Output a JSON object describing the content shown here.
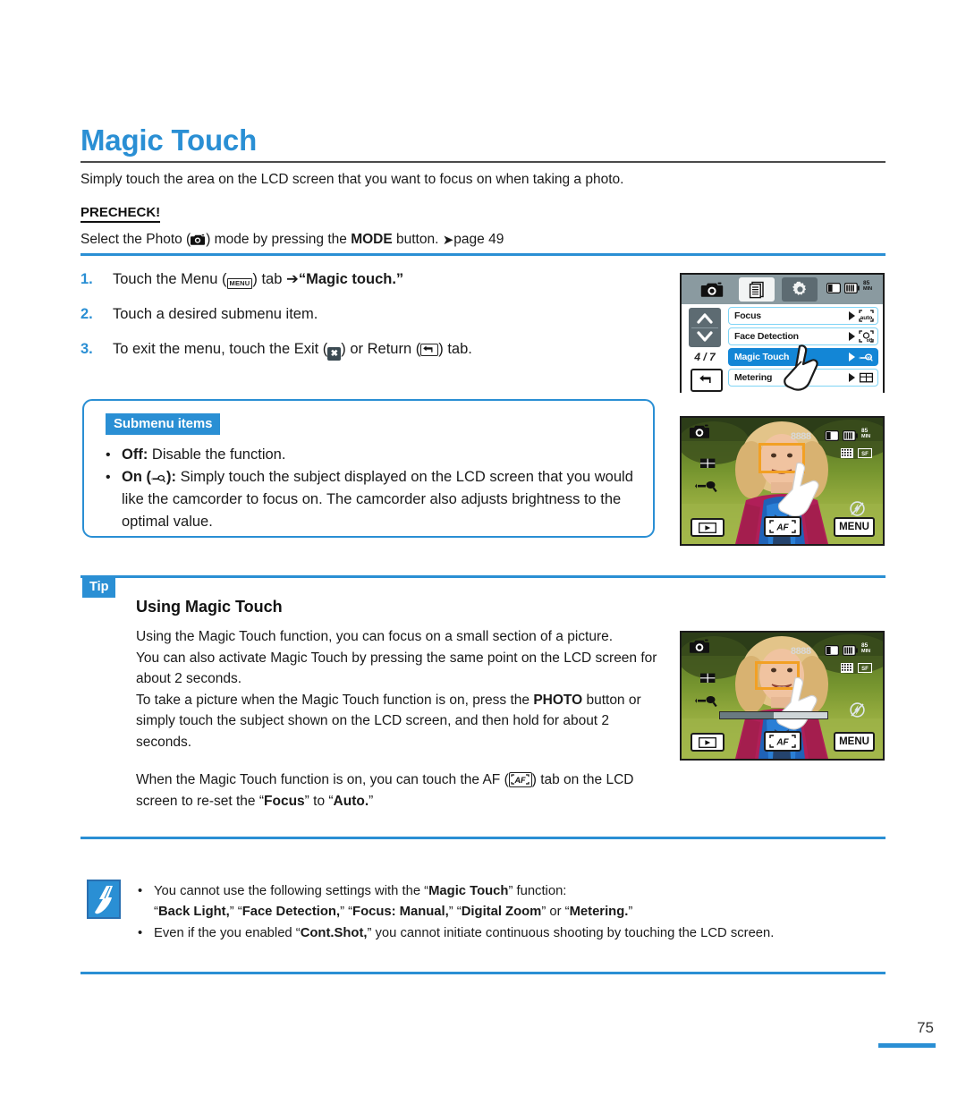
{
  "page": {
    "title": "Magic Touch",
    "intro": "Simply touch the area on the LCD screen that you want to focus on when taking a photo.",
    "precheck_label": "PRECHECK!",
    "precheck_prefix": "Select the Photo (",
    "precheck_mid": ") mode by pressing the ",
    "precheck_mode": "MODE",
    "precheck_suffix": " button. ",
    "precheck_ref": "page 49",
    "page_number": "75",
    "accent_color": "#2a8fd4"
  },
  "steps": [
    {
      "num": "1.",
      "pre": "Touch the Menu (",
      "chip": "MENU",
      "mid": ") tab ",
      "arrow": "➔",
      "bold": "“Magic touch.”",
      "post": ""
    },
    {
      "num": "2.",
      "pre": "Touch a desired submenu item.",
      "mid": "",
      "bold": "",
      "post": ""
    },
    {
      "num": "3.",
      "pre": "To exit the menu, touch the Exit (",
      "mid": ") or Return (",
      "post": ") tab."
    }
  ],
  "submenu": {
    "tag": "Submenu items",
    "items": [
      {
        "bold": "Off:",
        "text": " Disable the function."
      },
      {
        "bold": "On (",
        "icon": "magic-touch-icon",
        "bold2": "):",
        "text": " Simply touch the subject displayed on the LCD screen that you would like the camcorder to focus on. The camcorder also adjusts brightness to the optimal value."
      }
    ]
  },
  "tip": {
    "tag": "Tip",
    "heading": "Using Magic Touch",
    "paragraphs": [
      "Using the Magic Touch function, you can focus on a small section of a picture.",
      "You can also activate Magic Touch by pressing the same point on the LCD screen for about 2 seconds."
    ],
    "photo_para": {
      "pre": "To take a picture when the Magic Touch function is on, press the ",
      "bold": "PHOTO",
      "post": " button or simply touch the subject shown on the LCD screen, and then hold for about 2 seconds."
    },
    "af_para": {
      "pre": "When the Magic Touch function is on, you can touch the AF (",
      "mid": ") tab on the LCD screen to re-set the “",
      "bold1": "Focus",
      "mid2": "” to “",
      "bold2": "Auto.",
      "post": "”"
    }
  },
  "notes": [
    {
      "pre": "You cannot use the following settings with the “",
      "bold": "Magic Touch",
      "post": "” function:",
      "line2_parts": [
        {
          "q": true,
          "bold": "Back Light,",
          "sep": "” "
        },
        {
          "q": true,
          "bold": "Face Detection,",
          "sep": "” "
        },
        {
          "q": true,
          "bold": "Focus: Manual,",
          "sep": "” "
        },
        {
          "q": true,
          "bold": "Digital Zoom",
          "sep": "” or "
        },
        {
          "q": true,
          "bold": "Metering.",
          "sep": "”"
        }
      ]
    },
    {
      "pre": "Even if the you enabled “",
      "bold": "Cont.Shot,",
      "post": "” you cannot initiate continuous shooting by touching the LCD screen."
    }
  ],
  "lcd_menu": {
    "tabs": [
      "photo-tab",
      "menu-list-tab",
      "settings-tab"
    ],
    "status_icons": [
      "memory-card-icon",
      "battery-icon"
    ],
    "status_time": "85",
    "status_time_unit": "MIN",
    "page_indicator": "4 / 7",
    "rows": [
      {
        "label": "Focus",
        "selected": false,
        "value_icon": "focus-auto-icon"
      },
      {
        "label": "Face Detection",
        "selected": false,
        "value_icon": "face-detection-off-icon"
      },
      {
        "label": "Magic Touch",
        "selected": true,
        "value_icon": "magic-touch-on-icon"
      },
      {
        "label": "Metering",
        "selected": false,
        "value_icon": "metering-icon"
      }
    ]
  },
  "lcd_preview": {
    "counter": "8888",
    "battery_time": "85",
    "battery_time_unit": "MIN",
    "buttons": {
      "play": "play-icon",
      "af": "AF",
      "menu": "MENU"
    },
    "left_icons": [
      "photo-mode-icon",
      "metering-icon",
      "magic-touch-on-icon"
    ],
    "right_icons": [
      "flash-off-icon"
    ],
    "top_right_icons": [
      "memory-card-icon",
      "battery-icon",
      "resolution-icon",
      "quality-icon"
    ]
  }
}
